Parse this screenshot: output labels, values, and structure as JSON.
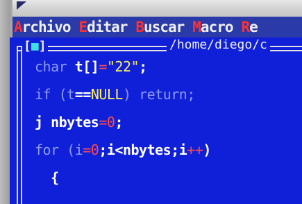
{
  "menubar": {
    "items": [
      {
        "hot": "A",
        "rest": "rchivo"
      },
      {
        "hot": "E",
        "rest": "ditar"
      },
      {
        "hot": "B",
        "rest": "uscar"
      },
      {
        "hot": "M",
        "rest": "acro"
      },
      {
        "hot": "R",
        "rest": "e"
      }
    ]
  },
  "editor": {
    "close_glyph": "■",
    "path": "/home/diego/c",
    "lines": [
      {
        "a": "char ",
        "b": "t[]",
        "c": "=",
        "d": "\"22\"",
        "e": ";"
      },
      {
        "a": "if (t",
        "b": "==",
        "c": "NULL",
        "d": ") return;"
      },
      {
        "a": "j ",
        "b": "nbytes",
        "c": "=",
        "d": "0",
        "e": ";"
      },
      {
        "a": "for (i",
        "b": "=",
        "c": "0",
        "d": ";i<nbytes;i",
        "e": "++",
        "f": ")"
      },
      {
        "a": "  {"
      }
    ]
  },
  "colors": {
    "menu_bg": "#2a3aa8",
    "editor_bg": "#1020d8",
    "hotkey": "#ff3030"
  }
}
